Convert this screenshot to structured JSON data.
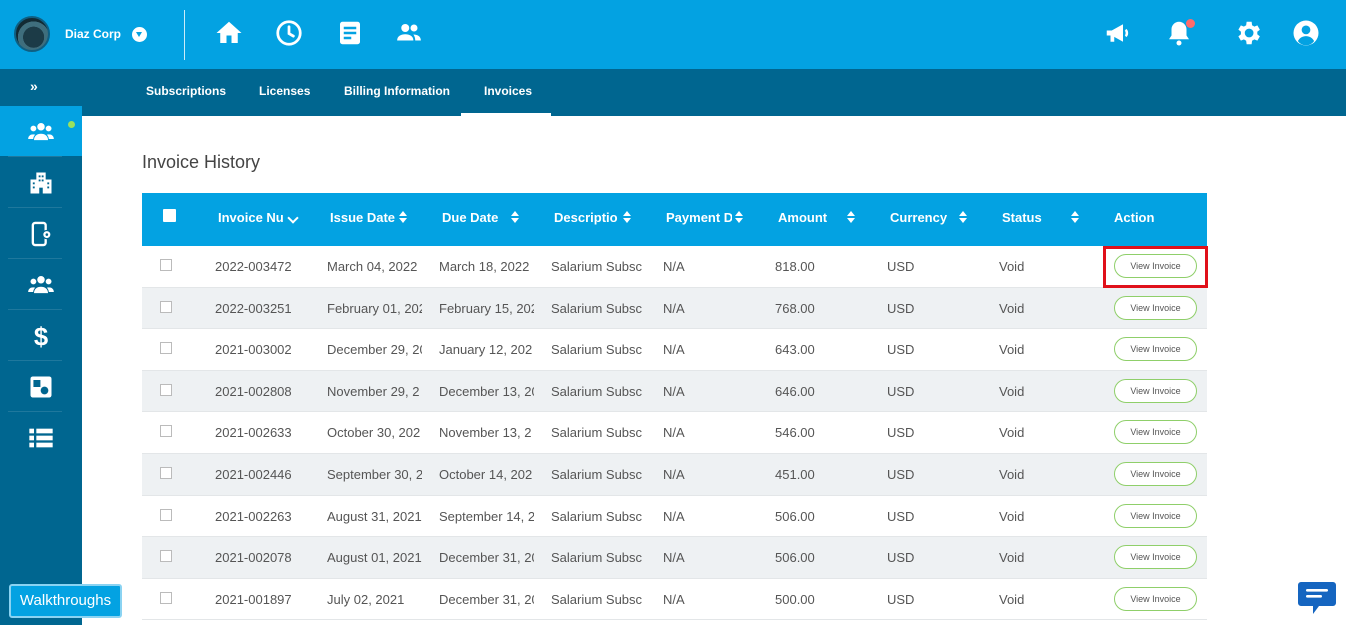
{
  "company": {
    "name": "Diaz Corp",
    "logo_icon": "company-logo"
  },
  "top_icons": [
    "home-icon",
    "clock-icon",
    "document-icon",
    "people-icon",
    "megaphone-icon",
    "bell-icon",
    "gear-icon",
    "user-circle-icon"
  ],
  "colors": {
    "primary": "#03a2e2",
    "secondary": "#006690",
    "highlight": "#e0101a",
    "button_border": "#8fcf6a"
  },
  "expand_label": "»",
  "tabs": [
    {
      "label": "Subscriptions"
    },
    {
      "label": "Licenses"
    },
    {
      "label": "Billing Information"
    },
    {
      "label": "Invoices",
      "active": true
    }
  ],
  "sidebar_icons": [
    "group-icon",
    "building-icon",
    "mobile-settings-icon",
    "group-icon",
    "dollar-icon",
    "shapes-icon",
    "list-icon"
  ],
  "page_title": "Invoice History",
  "columns": [
    "Invoice Nu",
    "Issue Date",
    "Due Date",
    "Descriptio",
    "Payment D",
    "Amount",
    "Currency",
    "Status",
    "Action"
  ],
  "rows": [
    {
      "invoice": "2022-003472",
      "issue": "March 04, 2022",
      "due": "March 18, 2022",
      "desc": "Salarium Subsc",
      "payment": "N/A",
      "amount": "818.00",
      "currency": "USD",
      "status": "Void",
      "action": "View Invoice"
    },
    {
      "invoice": "2022-003251",
      "issue": "February 01, 202",
      "due": "February 15, 202",
      "desc": "Salarium Subsc",
      "payment": "N/A",
      "amount": "768.00",
      "currency": "USD",
      "status": "Void",
      "action": "View Invoice"
    },
    {
      "invoice": "2021-003002",
      "issue": "December 29, 20",
      "due": "January 12, 202",
      "desc": "Salarium Subsc",
      "payment": "N/A",
      "amount": "643.00",
      "currency": "USD",
      "status": "Void",
      "action": "View Invoice"
    },
    {
      "invoice": "2021-002808",
      "issue": "November 29, 2",
      "due": "December 13, 20",
      "desc": "Salarium Subsc",
      "payment": "N/A",
      "amount": "646.00",
      "currency": "USD",
      "status": "Void",
      "action": "View Invoice"
    },
    {
      "invoice": "2021-002633",
      "issue": "October 30, 202",
      "due": "November 13, 2",
      "desc": "Salarium Subsc",
      "payment": "N/A",
      "amount": "546.00",
      "currency": "USD",
      "status": "Void",
      "action": "View Invoice"
    },
    {
      "invoice": "2021-002446",
      "issue": "September 30, 2",
      "due": "October 14, 202",
      "desc": "Salarium Subsc",
      "payment": "N/A",
      "amount": "451.00",
      "currency": "USD",
      "status": "Void",
      "action": "View Invoice"
    },
    {
      "invoice": "2021-002263",
      "issue": "August 31, 2021",
      "due": "September 14, 2",
      "desc": "Salarium Subsc",
      "payment": "N/A",
      "amount": "506.00",
      "currency": "USD",
      "status": "Void",
      "action": "View Invoice"
    },
    {
      "invoice": "2021-002078",
      "issue": "August 01, 2021",
      "due": "December 31, 20",
      "desc": "Salarium Subsc",
      "payment": "N/A",
      "amount": "506.00",
      "currency": "USD",
      "status": "Void",
      "action": "View Invoice"
    },
    {
      "invoice": "2021-001897",
      "issue": "July 02, 2021",
      "due": "December 31, 20",
      "desc": "Salarium Subsc",
      "payment": "N/A",
      "amount": "500.00",
      "currency": "USD",
      "status": "Void",
      "action": "View Invoice"
    }
  ],
  "walkthroughs_label": "Walkthroughs",
  "chat_icon": "chat-icon"
}
